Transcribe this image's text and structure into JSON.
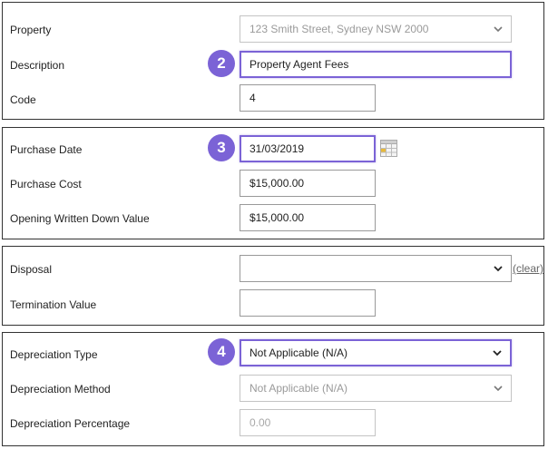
{
  "section1": {
    "property": {
      "label": "Property",
      "value": "123 Smith Street, Sydney NSW 2000"
    },
    "description": {
      "label": "Description",
      "value": "Property Agent Fees",
      "badge": "2"
    },
    "code": {
      "label": "Code",
      "value": "4"
    }
  },
  "section2": {
    "purchase_date": {
      "label": "Purchase Date",
      "value": "31/03/2019",
      "badge": "3"
    },
    "purchase_cost": {
      "label": "Purchase Cost",
      "value": "$15,000.00"
    },
    "opening_wdv": {
      "label": "Opening Written Down Value",
      "value": "$15,000.00"
    }
  },
  "section3": {
    "disposal": {
      "label": "Disposal",
      "value": "",
      "clear_label": "(clear)"
    },
    "termination_value": {
      "label": "Termination Value",
      "value": ""
    }
  },
  "section4": {
    "depreciation_type": {
      "label": "Depreciation Type",
      "value": "Not Applicable (N/A)",
      "badge": "4"
    },
    "depreciation_method": {
      "label": "Depreciation Method",
      "value": "Not Applicable (N/A)"
    },
    "depreciation_percentage": {
      "label": "Depreciation Percentage",
      "placeholder": "0.00"
    }
  },
  "colors": {
    "accent": "#7b63d6",
    "border": "#333333",
    "disabled_text": "#9a9a9a"
  },
  "icons": {
    "dropdown": "chevron-down-icon",
    "calendar": "calendar-icon"
  }
}
